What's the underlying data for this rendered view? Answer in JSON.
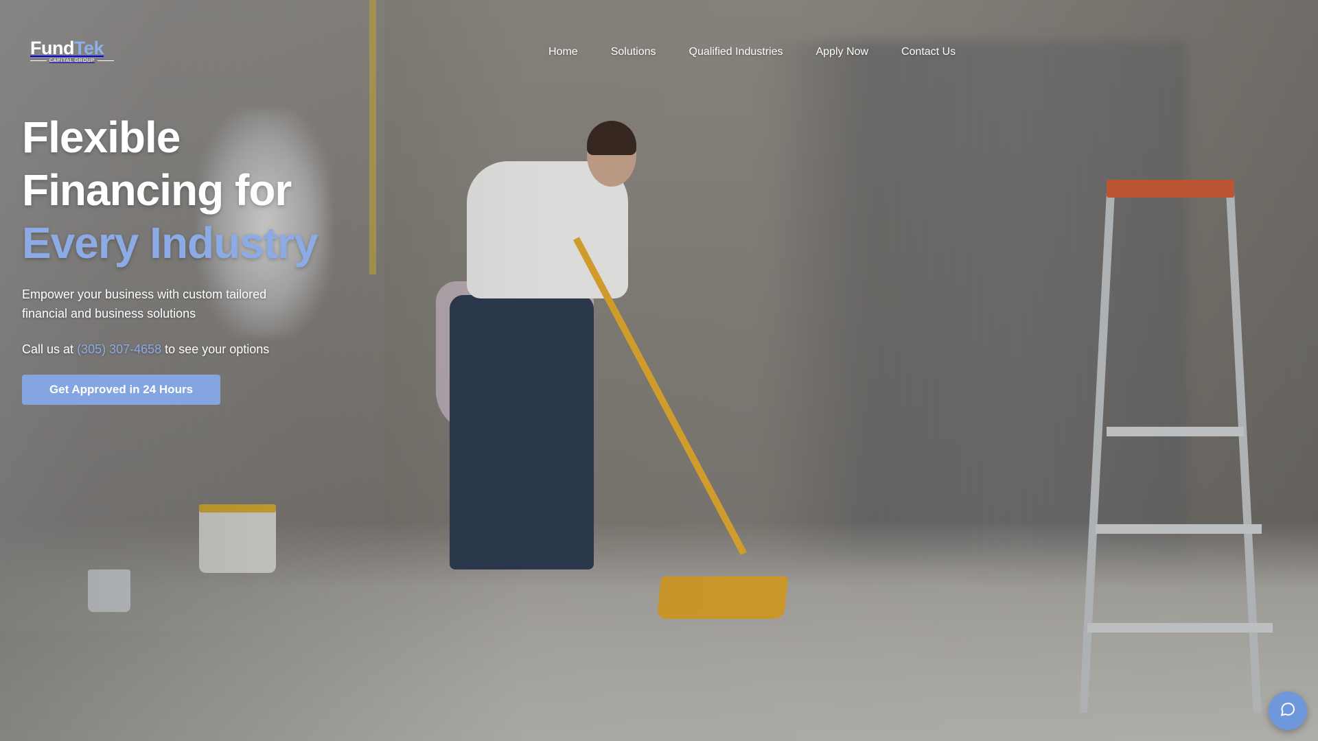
{
  "brand": {
    "name_part1": "Fund",
    "name_part2": "Tek",
    "tagline": "CAPITAL GROUP",
    "accent_color": "#8cabe4"
  },
  "nav": {
    "items": [
      {
        "label": "Home"
      },
      {
        "label": "Solutions"
      },
      {
        "label": "Qualified Industries"
      },
      {
        "label": "Apply Now"
      },
      {
        "label": "Contact Us"
      }
    ]
  },
  "hero": {
    "title_line1": "Flexible",
    "title_line2": "Financing for",
    "title_line3": "Every Industry",
    "subtitle": "Empower your business with custom tailored financial and business solutions",
    "call_prefix": "Call us at",
    "phone": "(305) 307-4658",
    "call_suffix": "to see your options",
    "cta_label": "Get Approved in 24 Hours",
    "cta_color": "#84a5e0"
  },
  "chat": {
    "icon": "chat-bubble-icon",
    "color": "#6f97db"
  },
  "background": {
    "icon": "hero-background-photo"
  }
}
